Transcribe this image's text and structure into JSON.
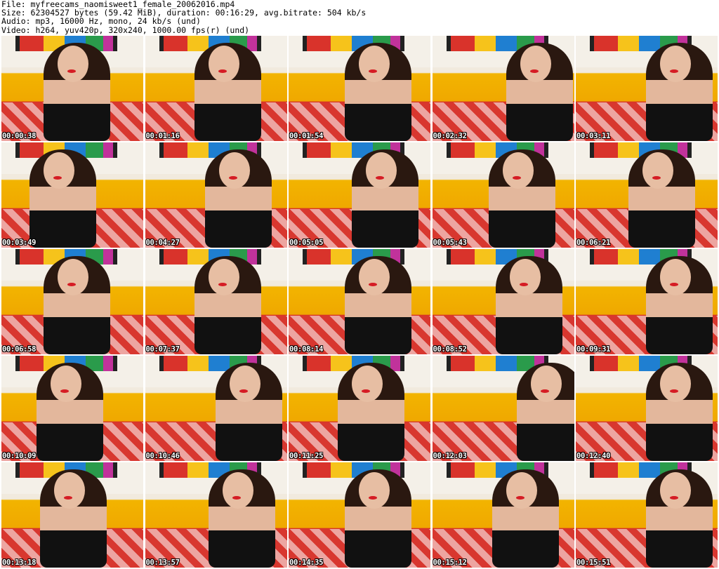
{
  "header": {
    "file_line": "File: myfreecams_naomisweet1_female_20062016.mp4",
    "size_line": "Size: 62304527 bytes (59.42 MiB), duration: 00:16:29, avg.bitrate: 504 kb/s",
    "audio_line": "Audio: mp3, 16000 Hz, mono, 24 kb/s (und)",
    "video_line": "Video: h264, yuv420p, 320x240, 1000.00 fps(r) (und)"
  },
  "thumbnails": [
    {
      "timestamp": "00:00:38"
    },
    {
      "timestamp": "00:01:16"
    },
    {
      "timestamp": "00:01:54"
    },
    {
      "timestamp": "00:02:32"
    },
    {
      "timestamp": "00:03:11"
    },
    {
      "timestamp": "00:03:49"
    },
    {
      "timestamp": "00:04:27"
    },
    {
      "timestamp": "00:05:05"
    },
    {
      "timestamp": "00:05:43"
    },
    {
      "timestamp": "00:06:21"
    },
    {
      "timestamp": "00:06:58"
    },
    {
      "timestamp": "00:07:37"
    },
    {
      "timestamp": "00:08:14"
    },
    {
      "timestamp": "00:08:52"
    },
    {
      "timestamp": "00:09:31"
    },
    {
      "timestamp": "00:10:09"
    },
    {
      "timestamp": "00:10:46"
    },
    {
      "timestamp": "00:11:25"
    },
    {
      "timestamp": "00:12:03"
    },
    {
      "timestamp": "00:12:40"
    },
    {
      "timestamp": "00:13:18"
    },
    {
      "timestamp": "00:13:57"
    },
    {
      "timestamp": "00:14:35"
    },
    {
      "timestamp": "00:15:12"
    },
    {
      "timestamp": "00:15:51"
    }
  ]
}
